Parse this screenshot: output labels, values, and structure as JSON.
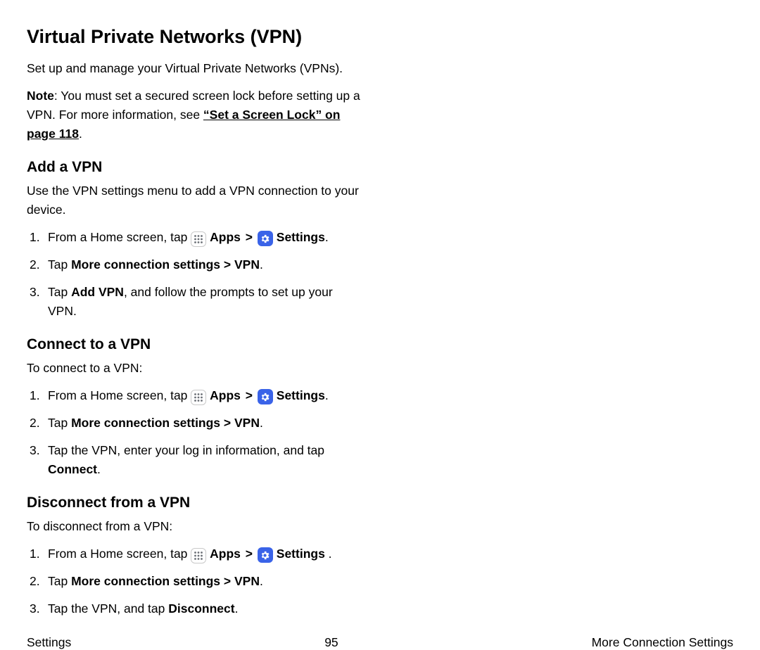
{
  "title": "Virtual Private Networks (VPN)",
  "intro": "Set up and manage your Virtual Private Networks (VPNs).",
  "note_label": "Note",
  "note_body": ": You must set a secured screen lock before setting up a VPN. For more information, see ",
  "note_link": "“Set a Screen Lock” on page 118",
  "note_tail": ".",
  "labels": {
    "apps": "Apps",
    "chevron": ">",
    "settings": "Settings",
    "settings_trail": " .",
    "period": ".",
    "home_prefix": "From a Home screen, tap ",
    "tap_prefix": "Tap ",
    "more_conn": "More connection settings > VPN",
    "add_vpn": "Add VPN",
    "connect": "Connect",
    "disconnect": "Disconnect"
  },
  "sections": {
    "add": {
      "heading": "Add a VPN",
      "intro": "Use the VPN settings menu to add a VPN connection to your device.",
      "step3_tail": ", and follow the prompts to set up your VPN."
    },
    "connect": {
      "heading": "Connect to a VPN",
      "intro": "To connect to a VPN:",
      "step3_lead": "Tap the VPN, enter your log in information, and tap "
    },
    "disconnect": {
      "heading": "Disconnect from a VPN",
      "intro": "To disconnect from a VPN:",
      "step3_lead": "Tap the VPN, and tap "
    }
  },
  "footer": {
    "left": "Settings",
    "page": "95",
    "right": "More Connection Settings"
  }
}
